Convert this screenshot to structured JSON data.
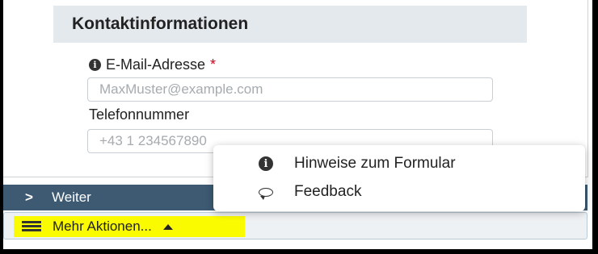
{
  "section": {
    "title": "Kontaktinformationen"
  },
  "email": {
    "info_icon": "info-icon",
    "label": "E-Mail-Adresse",
    "required_mark": "*",
    "placeholder": "MaxMuster@example.com"
  },
  "phone": {
    "label": "Telefonnummer",
    "placeholder": "+43 1 234567890"
  },
  "nav": {
    "next_icon": "chevron-right-icon",
    "next_label": "Weiter",
    "next_chevron": ">"
  },
  "actions": {
    "icon": "hamburger-icon",
    "label": "Mehr Aktionen...",
    "highlight_color": "#fbfb00"
  },
  "menu": {
    "items": [
      {
        "icon": "info-icon",
        "label": "Hinweise zum Formular"
      },
      {
        "icon": "speech-bubble-icon",
        "label": "Feedback"
      }
    ]
  },
  "colors": {
    "section_header_bg": "#e4e9ed",
    "nav_bar_bg": "#3d5a72",
    "required": "#d0021b"
  }
}
